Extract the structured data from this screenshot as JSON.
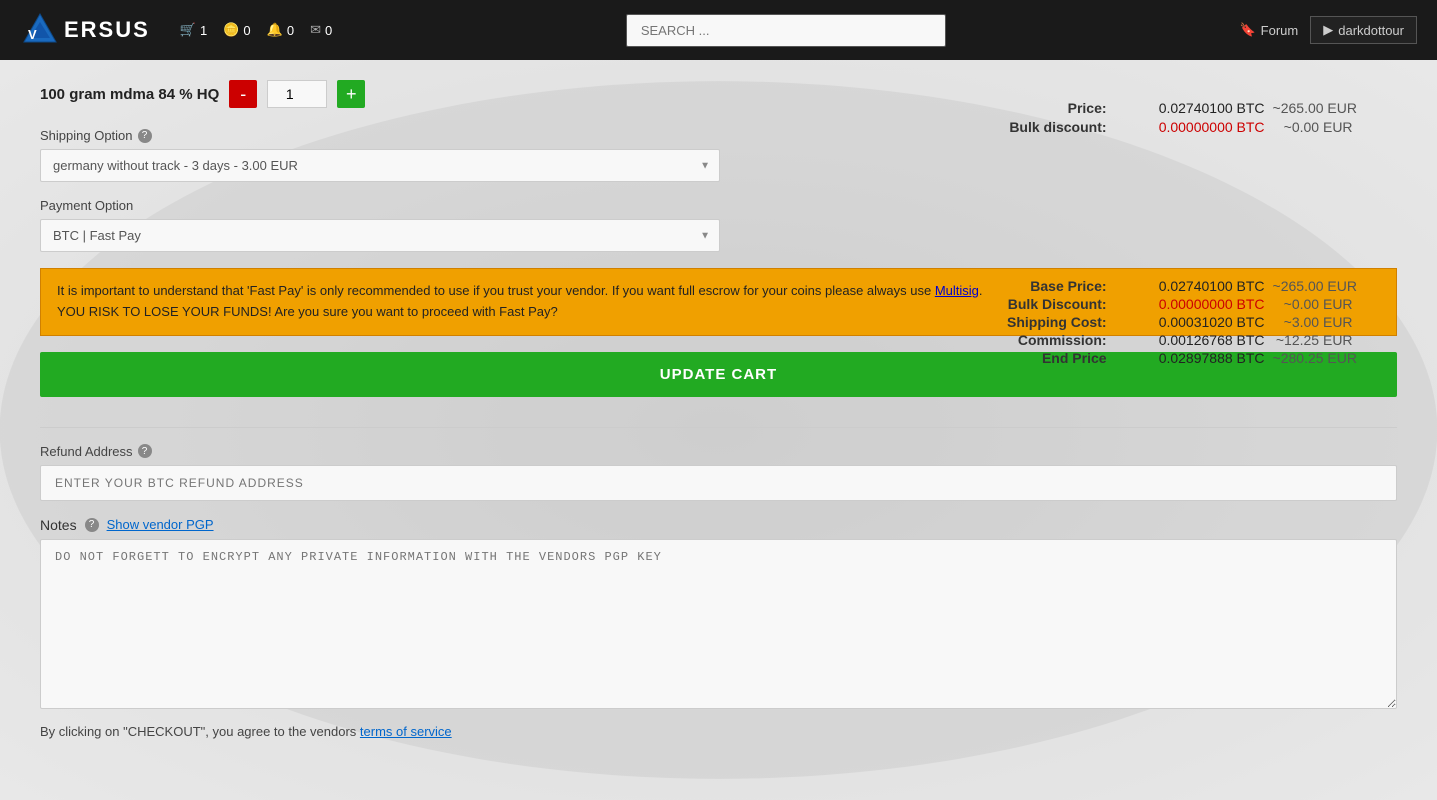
{
  "header": {
    "logo_text": "ERSUS",
    "cart_count": "1",
    "coins_count": "0",
    "notifications_count": "0",
    "messages_count": "0",
    "search_placeholder": "SEARCH ...",
    "forum_label": "Forum",
    "user_label": "darkdottour"
  },
  "product": {
    "name": "100 gram mdma 84 % HQ",
    "quantity": "1",
    "minus_label": "-",
    "plus_label": "+"
  },
  "pricing": {
    "price_label": "Price:",
    "price_btc": "0.02740100 BTC",
    "price_eur": "~265.00 EUR",
    "bulk_discount_label": "Bulk discount:",
    "bulk_discount_btc": "0.00000000 BTC",
    "bulk_discount_eur": "~0.00 EUR"
  },
  "summary": {
    "base_price_label": "Base Price:",
    "base_price_btc": "0.02740100 BTC",
    "base_price_eur": "~265.00 EUR",
    "bulk_discount_label": "Bulk Discount:",
    "bulk_discount_btc": "0.00000000 BTC",
    "bulk_discount_eur": "~0.00 EUR",
    "shipping_cost_label": "Shipping Cost:",
    "shipping_cost_btc": "0.00031020 BTC",
    "shipping_cost_eur": "~3.00 EUR",
    "commission_label": "Commission:",
    "commission_btc": "0.00126768 BTC",
    "commission_eur": "~12.25 EUR",
    "end_price_label": "End Price",
    "end_price_btc": "0.02897888 BTC",
    "end_price_eur": "~280.25 EUR"
  },
  "shipping": {
    "label": "Shipping Option",
    "option": "germany without track - 3 days - 3.00 EUR"
  },
  "payment": {
    "label": "Payment Option",
    "option": "BTC | Fast Pay"
  },
  "warning": {
    "text1": "It is important to understand that 'Fast Pay' is only recommended to use if you trust your vendor. If you want full escrow for your coins please always use ",
    "link_text": "Multisig",
    "text2": ".",
    "text3": "YOU RISK TO LOSE YOUR FUNDS! Are you sure you want to proceed with Fast Pay?"
  },
  "update_cart_label": "UPDATE CART",
  "refund": {
    "label": "Refund Address",
    "placeholder": "ENTER YOUR BTC REFUND ADDRESS"
  },
  "notes": {
    "label": "Notes",
    "show_pgp_label": "Show vendor PGP",
    "placeholder": "DO NOT FORGETT TO ENCRYPT ANY PRIVATE INFORMATION WITH THE VENDORS PGP KEY"
  },
  "footer": {
    "text": "By clicking on \"CHECKOUT\", you agree to the vendors ",
    "tos_link": "terms of service"
  }
}
